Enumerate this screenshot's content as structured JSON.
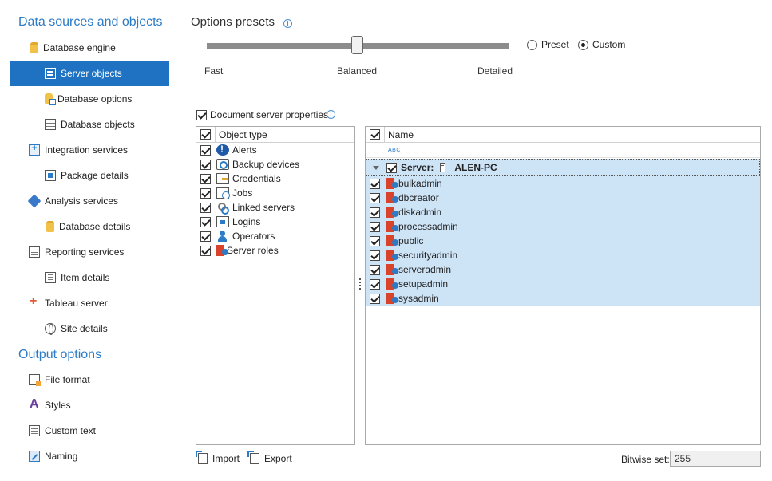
{
  "sidebar": {
    "section1": "Data sources and objects",
    "section2": "Output options",
    "items": [
      {
        "label": "Database engine",
        "icon": "database-icon"
      },
      {
        "label": "Server objects",
        "icon": "server-objects-icon"
      },
      {
        "label": "Database options",
        "icon": "database-options-icon"
      },
      {
        "label": "Database objects",
        "icon": "table-icon"
      },
      {
        "label": "Integration services",
        "icon": "integration-icon"
      },
      {
        "label": "Package details",
        "icon": "package-icon"
      },
      {
        "label": "Analysis services",
        "icon": "cube-icon"
      },
      {
        "label": "Database details",
        "icon": "database-icon"
      },
      {
        "label": "Reporting services",
        "icon": "report-icon"
      },
      {
        "label": "Item details",
        "icon": "document-icon"
      },
      {
        "label": "Tableau server",
        "icon": "tableau-icon"
      },
      {
        "label": "Site details",
        "icon": "globe-icon"
      }
    ],
    "output_items": [
      {
        "label": "File format",
        "icon": "file-format-icon"
      },
      {
        "label": "Styles",
        "icon": "styles-icon"
      },
      {
        "label": "Custom text",
        "icon": "custom-text-icon"
      },
      {
        "label": "Naming",
        "icon": "naming-icon"
      }
    ],
    "active_index": 1
  },
  "presets": {
    "title": "Options presets",
    "slider_labels": [
      "Fast",
      "Balanced",
      "Detailed"
    ],
    "slider_value": "Balanced",
    "radio_preset": "Preset",
    "radio_custom": "Custom",
    "selected_radio": "Custom"
  },
  "doc_props": {
    "label": "Document server properties",
    "checked": true
  },
  "object_types": {
    "header": "Object type",
    "items": [
      {
        "label": "Alerts",
        "icon": "alert-icon"
      },
      {
        "label": "Backup devices",
        "icon": "backup-device-icon"
      },
      {
        "label": "Credentials",
        "icon": "credentials-icon"
      },
      {
        "label": "Jobs",
        "icon": "jobs-icon"
      },
      {
        "label": "Linked servers",
        "icon": "linked-servers-icon"
      },
      {
        "label": "Logins",
        "icon": "logins-icon"
      },
      {
        "label": "Operators",
        "icon": "operators-icon"
      },
      {
        "label": "Server roles",
        "icon": "server-roles-icon"
      }
    ]
  },
  "names": {
    "header": "Name",
    "filter_glyph": "ABC",
    "server_prefix": "Server:",
    "server_name": "ALEN-PC",
    "roles": [
      "bulkadmin",
      "dbcreator",
      "diskadmin",
      "processadmin",
      "public",
      "securityadmin",
      "serveradmin",
      "setupadmin",
      "sysadmin"
    ]
  },
  "footer": {
    "import_label": "Import",
    "export_label": "Export",
    "bitwise_label": "Bitwise set:",
    "bitwise_value": "255"
  },
  "colors": {
    "accent": "#1e72c1",
    "selection": "#cde3f6",
    "section_title": "#2b7bc7"
  }
}
